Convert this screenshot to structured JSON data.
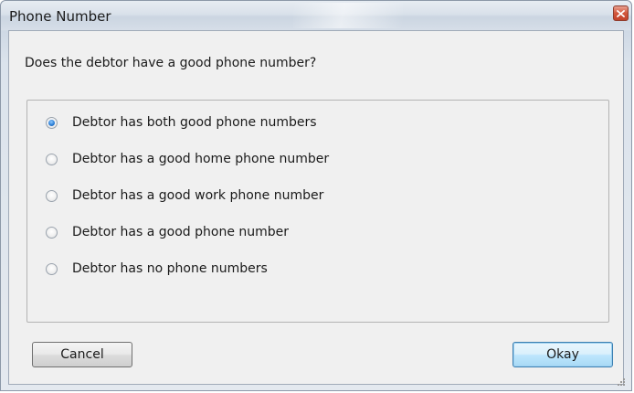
{
  "window": {
    "title": "Phone Number"
  },
  "prompt": {
    "question": "Does the debtor have a good phone number?"
  },
  "options": [
    {
      "label": "Debtor has both good phone numbers",
      "checked": true
    },
    {
      "label": "Debtor has a good home phone number",
      "checked": false
    },
    {
      "label": "Debtor has a good work phone number",
      "checked": false
    },
    {
      "label": "Debtor has a good phone number",
      "checked": false
    },
    {
      "label": "Debtor has no phone numbers",
      "checked": false
    }
  ],
  "buttons": {
    "cancel_label": "Cancel",
    "okay_label": "Okay"
  },
  "icons": {
    "close": "close-icon",
    "radio": "radio-icon",
    "resize_grip": "resize-grip-icon"
  },
  "colors": {
    "radio_selected": "#2c7fd6",
    "close_button": "#c2422a",
    "default_button_border": "#3c7fb1"
  }
}
